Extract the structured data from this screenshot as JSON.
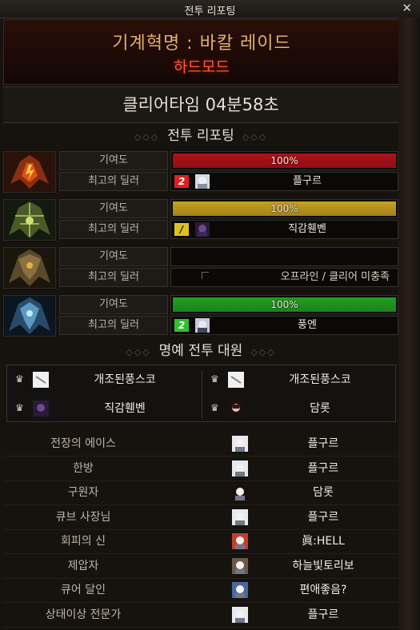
{
  "window": {
    "title": "전투 리포팅",
    "close_glyph": "✕"
  },
  "header": {
    "raid_name": "기계혁명 : 바칼 레이드",
    "mode": "하드모드"
  },
  "clear_time": "클리어타임  04분58초",
  "sections": {
    "report_title": "전투 리포팅",
    "honor_title": "명예 전투 대원",
    "ornament": "◇◇◇"
  },
  "labels": {
    "contribution": "기여도",
    "top_dealer": "최고의 딜러"
  },
  "colors": {
    "red": "#b01018",
    "gold": "#c8a020",
    "green": "#20a020",
    "rank_red": "#e02020",
    "rank_gold": "#e0c020",
    "rank_green": "#30c030"
  },
  "bosses": [
    {
      "icon": "fire-dragon-icon",
      "contribution": "100%",
      "fill": 1.0,
      "bar_color": "#b01018",
      "rank": "2",
      "rank_color": "#e02020",
      "dealer": "플구르"
    },
    {
      "icon": "thorn-dragon-icon",
      "contribution": "100%",
      "fill": 1.0,
      "bar_color": "#c8a020",
      "rank": "/",
      "rank_color": "#e0c020",
      "dealer": "직감휀벤"
    },
    {
      "icon": "gold-dragon-icon",
      "contribution": "",
      "fill": 0,
      "bar_color": "",
      "rank": "",
      "rank_color": "",
      "dealer": "",
      "offline_text": "오프라인 / 클리어 미충족"
    },
    {
      "icon": "ice-dragon-icon",
      "contribution": "100%",
      "fill": 1.0,
      "bar_color": "#20a020",
      "rank": "2",
      "rank_color": "#30c030",
      "dealer": "풍엔"
    }
  ],
  "honor_members": [
    "개조된풍스코",
    "개조된풍스코",
    "직감휀벤",
    "담롯"
  ],
  "awards": [
    {
      "title": "전장의 에이스",
      "name": "플구르"
    },
    {
      "title": "한방",
      "name": "플구르"
    },
    {
      "title": "구원자",
      "name": "담롯"
    },
    {
      "title": "큐브 사장님",
      "name": "플구르"
    },
    {
      "title": "회피의 신",
      "name": "眞:HELL"
    },
    {
      "title": "제압자",
      "name": "하늘빛토리보"
    },
    {
      "title": "큐어 달인",
      "name": "편애좋음?"
    },
    {
      "title": "상태이상 전문가",
      "name": "플구르"
    }
  ]
}
